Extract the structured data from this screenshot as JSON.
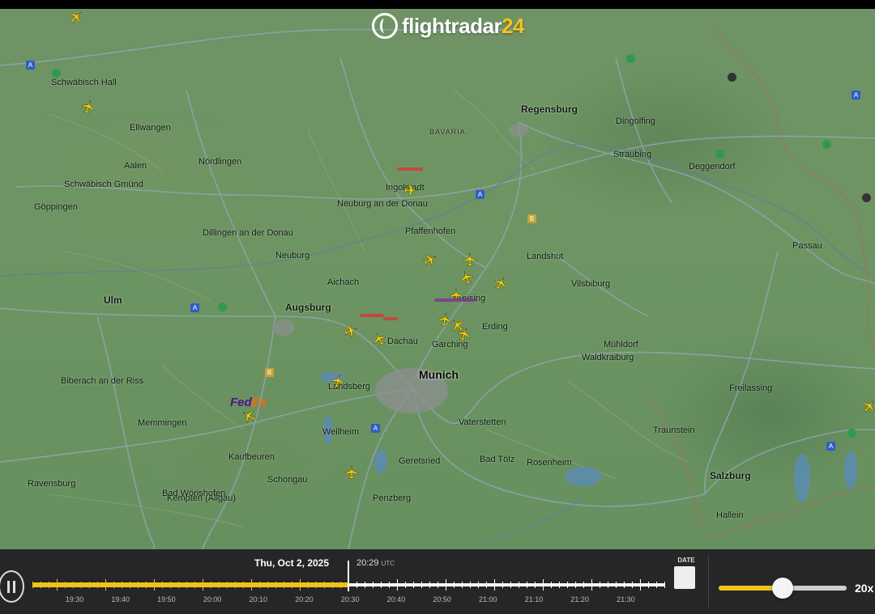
{
  "app": {
    "logo_word": "flightradar",
    "logo_num": "24"
  },
  "map": {
    "cities": [
      {
        "name": "Munich",
        "cls": "big"
      },
      {
        "name": "Augsburg",
        "cls": "mid"
      },
      {
        "name": "Regensburg",
        "cls": "mid"
      },
      {
        "name": "Salzburg",
        "cls": "mid"
      },
      {
        "name": "Ulm",
        "cls": "mid"
      },
      {
        "name": "BAVARIA",
        "cls": "region"
      },
      {
        "name": "Ingolstadt",
        "cls": ""
      },
      {
        "name": "Landshut",
        "cls": ""
      },
      {
        "name": "Freising",
        "cls": ""
      },
      {
        "name": "Erding",
        "cls": ""
      },
      {
        "name": "Dachau",
        "cls": ""
      },
      {
        "name": "Garching",
        "cls": ""
      },
      {
        "name": "Passau",
        "cls": ""
      },
      {
        "name": "Rosenheim",
        "cls": ""
      },
      {
        "name": "Memmingen",
        "cls": ""
      },
      {
        "name": "Kaufbeuren",
        "cls": ""
      },
      {
        "name": "Kempten (Allgäu)",
        "cls": ""
      },
      {
        "name": "Ravensburg",
        "cls": ""
      },
      {
        "name": "Aalen",
        "cls": ""
      },
      {
        "name": "Nördlingen",
        "cls": ""
      },
      {
        "name": "Göppingen",
        "cls": ""
      },
      {
        "name": "Schwäbisch Gmünd",
        "cls": ""
      },
      {
        "name": "Schwäbisch Hall",
        "cls": ""
      },
      {
        "name": "Ellwangen",
        "cls": ""
      },
      {
        "name": "Dillingen an der Donau",
        "cls": ""
      },
      {
        "name": "Neuburg an der Donau",
        "cls": ""
      },
      {
        "name": "Landsberg",
        "cls": ""
      },
      {
        "name": "Bad Wörishofen",
        "cls": ""
      },
      {
        "name": "Straubing",
        "cls": ""
      },
      {
        "name": "Deggendorf",
        "cls": ""
      },
      {
        "name": "Vilsbiburg",
        "cls": ""
      },
      {
        "name": "Mühldorf",
        "cls": ""
      },
      {
        "name": "Waldkraiburg",
        "cls": ""
      },
      {
        "name": "Traunstein",
        "cls": ""
      },
      {
        "name": "Dingolfing",
        "cls": ""
      },
      {
        "name": "Geretsried",
        "cls": ""
      },
      {
        "name": "Biberach an der Riss",
        "cls": ""
      },
      {
        "name": "Penzberg",
        "cls": ""
      },
      {
        "name": "Vaterstetten",
        "cls": ""
      },
      {
        "name": "Freilassing",
        "cls": ""
      },
      {
        "name": "Pfaffenhofen",
        "cls": ""
      },
      {
        "name": "Aichach",
        "cls": ""
      },
      {
        "name": "Neuburg",
        "cls": ""
      },
      {
        "name": "Weilheim",
        "cls": ""
      },
      {
        "name": "Bad Tölz",
        "cls": ""
      },
      {
        "name": "Hallein",
        "cls": ""
      },
      {
        "name": "Schongau",
        "cls": ""
      }
    ],
    "airline_tag": {
      "fed": "Fed",
      "ex": "Ex"
    }
  },
  "playback": {
    "date": "Thu, Oct 2, 2025",
    "time": "20:29",
    "time_zone": "UTC",
    "date_button_label": "DATE",
    "speed_label": "20x",
    "speed_fraction": 0.5,
    "timeline_progress": 0.5,
    "tick_labels": [
      "19:30",
      "19:40",
      "19:50",
      "20:00",
      "20:10",
      "20:20",
      "20:30",
      "20:40",
      "20:50",
      "21:00",
      "21:10",
      "21:20",
      "21:30"
    ]
  },
  "colors": {
    "accent": "#f2c21a",
    "plane": "#f5d20e",
    "bar_bg": "#252627"
  },
  "icons": [
    "pause-icon",
    "calendar-icon",
    "airplane-icon",
    "airport-marker-icon",
    "highway-shield-icon"
  ]
}
